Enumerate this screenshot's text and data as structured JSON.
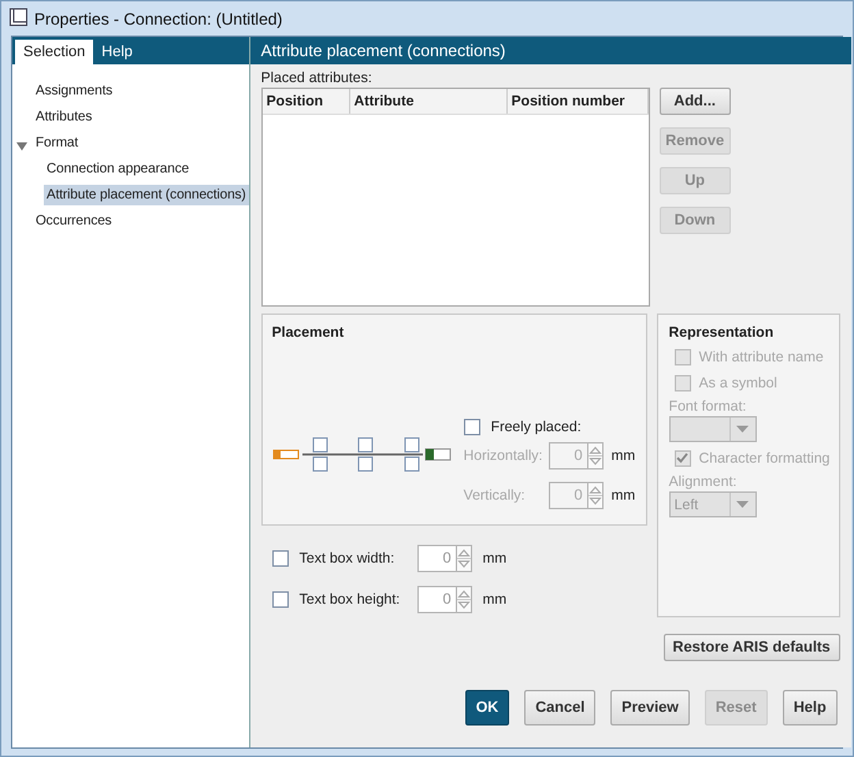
{
  "window": {
    "title": "Properties - Connection: (Untitled)"
  },
  "tabs": [
    {
      "label": "Selection",
      "selected": true
    },
    {
      "label": "Help",
      "selected": false
    }
  ],
  "tree": [
    {
      "label": "Assignments",
      "selected": false
    },
    {
      "label": "Attributes",
      "selected": false
    },
    {
      "label": "Format",
      "selected": false,
      "expanded": true,
      "children": [
        {
          "label": "Connection appearance",
          "selected": false
        },
        {
          "label": "Attribute placement (connections)",
          "selected": true
        }
      ]
    },
    {
      "label": "Occurrences",
      "selected": false
    }
  ],
  "panel": {
    "title": "Attribute placement (connections)",
    "placed_attributes": {
      "label": "Placed attributes:",
      "columns": [
        "Position",
        "Attribute",
        "Position number"
      ]
    },
    "side_buttons": [
      {
        "label": "Add...",
        "disabled": false
      },
      {
        "label": "Remove",
        "disabled": true
      },
      {
        "label": "Up",
        "disabled": true
      },
      {
        "label": "Down",
        "disabled": true
      }
    ],
    "placement": {
      "title": "Placement",
      "freely_placed": {
        "label": "Freely placed:",
        "checked": false
      },
      "fields": [
        {
          "label": "Horizontally:",
          "value": "0",
          "unit": "mm",
          "disabled": true
        },
        {
          "label": "Vertically:",
          "value": "0",
          "unit": "mm",
          "disabled": true
        }
      ]
    },
    "text_box": [
      {
        "label": "Text box width:",
        "checked": false,
        "value": "0",
        "unit": "mm"
      },
      {
        "label": "Text box height:",
        "checked": false,
        "value": "0",
        "unit": "mm"
      }
    ],
    "representation": {
      "title": "Representation",
      "options": [
        {
          "kind": "checkbox",
          "label": "With attribute name",
          "checked": false,
          "disabled": true
        },
        {
          "kind": "checkbox",
          "label": "As a symbol",
          "checked": false,
          "disabled": true
        },
        {
          "kind": "dropdown",
          "label": "Font format:",
          "disabled": true
        },
        {
          "kind": "checkbox",
          "label": "Character formatting",
          "checked": true,
          "disabled": true
        },
        {
          "kind": "dropdown",
          "label": "Alignment:",
          "value": "Left",
          "disabled": true
        }
      ]
    },
    "restore_button": {
      "label": "Restore ARIS defaults"
    }
  },
  "buttons": [
    {
      "label": "OK",
      "kind": "default",
      "disabled": false
    },
    {
      "label": "Cancel",
      "kind": "normal",
      "disabled": false
    },
    {
      "label": "Preview",
      "kind": "normal",
      "disabled": false
    },
    {
      "label": "Reset",
      "kind": "normal",
      "disabled": true
    },
    {
      "label": "Help",
      "kind": "normal",
      "disabled": false
    }
  ]
}
